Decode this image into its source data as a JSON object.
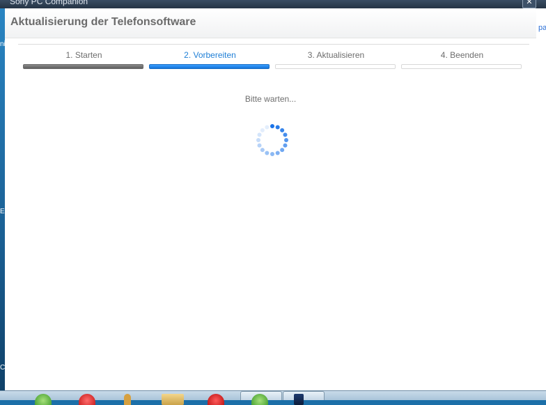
{
  "window": {
    "title": "Sony PC Companion",
    "close_glyph": "✕"
  },
  "desktop": {
    "right_snippet": "pa",
    "left_marks": [
      "ni",
      "E",
      "C"
    ]
  },
  "dialog": {
    "title": "Aktualisierung der Telefonsoftware",
    "steps": [
      {
        "label": "1. Starten",
        "state": "done"
      },
      {
        "label": "2. Vorbereiten",
        "state": "active"
      },
      {
        "label": "3. Aktualisieren",
        "state": "pending"
      },
      {
        "label": "4. Beenden",
        "state": "pending"
      }
    ],
    "status_text": "Bitte warten..."
  },
  "spinner": {
    "icon": "loading-spinner-icon",
    "color": "#1a73e8"
  },
  "taskbar": {
    "icons": [
      "green-orb-icon",
      "red-record-icon",
      "pen-icon",
      "folder-icon",
      "opera-icon",
      "green-orb-icon",
      "phone-icon"
    ]
  },
  "colors": {
    "accent": "#1f7fd6",
    "done": "#6a6a6a",
    "title": "#6b6b6b"
  }
}
